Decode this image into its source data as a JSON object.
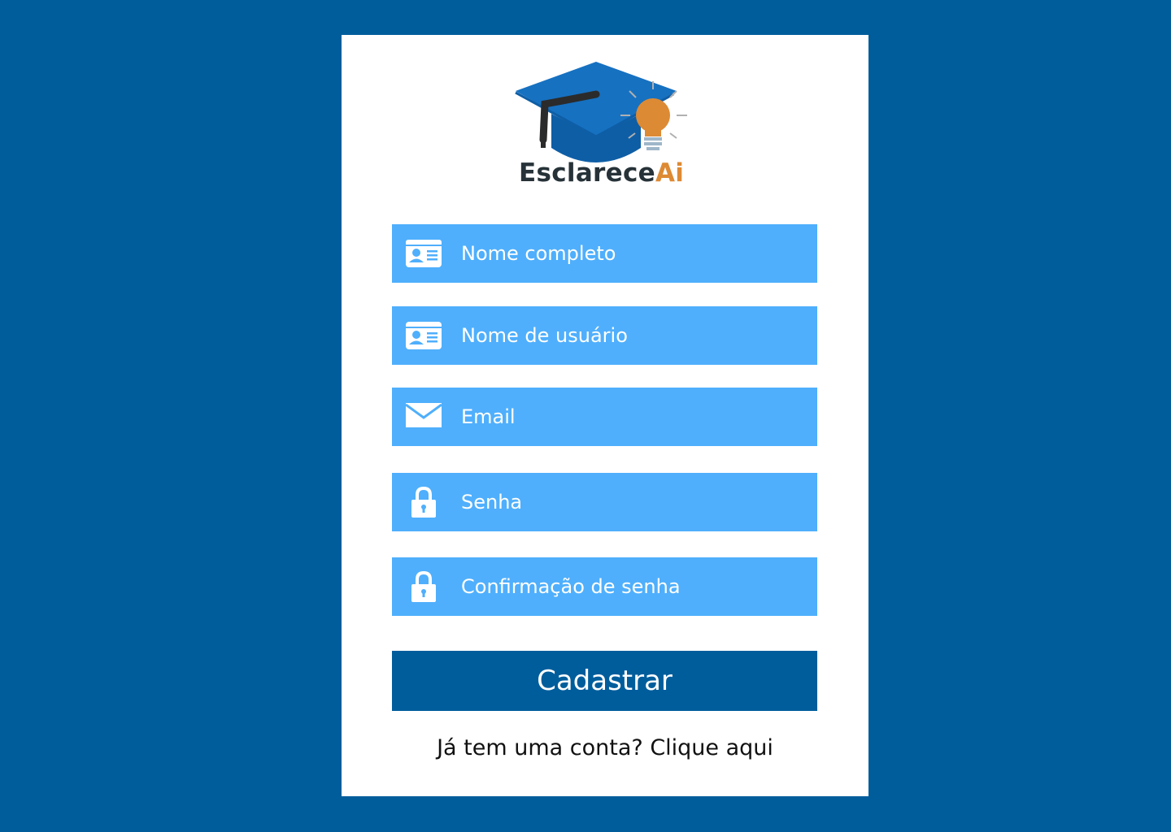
{
  "brand": {
    "name_main": "Esclarece",
    "name_accent": "Ai",
    "logo_icon": "graduation-cap-lightbulb-icon"
  },
  "colors": {
    "background": "#005d9c",
    "card": "#ffffff",
    "field": "#4faffc",
    "button": "#005d9c",
    "logo_text": "#263238",
    "logo_accent": "#dd8a34"
  },
  "form": {
    "fields": [
      {
        "placeholder": "Nome completo",
        "icon": "id-card-icon"
      },
      {
        "placeholder": "Nome de usuário",
        "icon": "id-card-icon"
      },
      {
        "placeholder": "Email",
        "icon": "envelope-icon"
      },
      {
        "placeholder": "Senha",
        "icon": "lock-icon"
      },
      {
        "placeholder": "Confirmação de senha",
        "icon": "lock-icon"
      }
    ],
    "submit_label": "Cadastrar"
  },
  "login_prompt": {
    "text": "Já tem uma conta?",
    "link": "Clique aqui"
  }
}
